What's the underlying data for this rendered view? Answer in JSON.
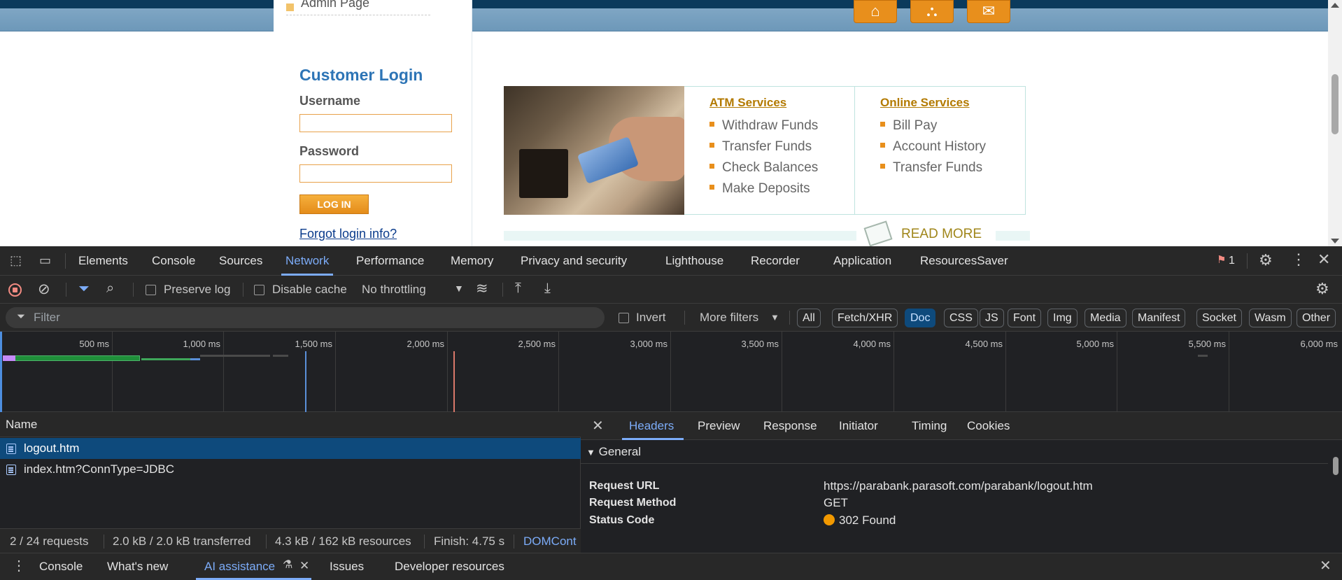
{
  "website": {
    "admin_link": "Admin Page",
    "login": {
      "title": "Customer Login",
      "username_label": "Username",
      "password_label": "Password",
      "login_button": "LOG IN",
      "forgot_link": "Forgot login info?"
    },
    "atm_services": {
      "heading": "ATM Services",
      "items": [
        "Withdraw Funds",
        "Transfer Funds",
        "Check Balances",
        "Make Deposits"
      ]
    },
    "online_services": {
      "heading": "Online Services",
      "items": [
        "Bill Pay",
        "Account History",
        "Transfer Funds"
      ]
    },
    "read_more": "READ MORE",
    "top_icons": [
      "home-icon",
      "about-icon",
      "contact-mail-icon"
    ]
  },
  "devtools": {
    "tabs": [
      "Elements",
      "Console",
      "Sources",
      "Network",
      "Performance",
      "Memory",
      "Privacy and security",
      "Lighthouse",
      "Recorder",
      "Application",
      "ResourcesSaver"
    ],
    "active_tab": "Network",
    "issues_count": "1",
    "toolbar": {
      "preserve_log": "Preserve log",
      "disable_cache": "Disable cache",
      "throttling": "No throttling"
    },
    "filter": {
      "placeholder": "Filter",
      "invert": "Invert",
      "more_filters": "More filters",
      "types": [
        "All",
        "Fetch/XHR",
        "Doc",
        "CSS",
        "JS",
        "Font",
        "Img",
        "Media",
        "Manifest",
        "Socket",
        "Wasm",
        "Other"
      ],
      "active_type": "Doc"
    },
    "timeline_ticks": [
      "500 ms",
      "1,000 ms",
      "1,500 ms",
      "2,000 ms",
      "2,500 ms",
      "3,000 ms",
      "3,500 ms",
      "4,000 ms",
      "4,500 ms",
      "5,000 ms",
      "5,500 ms",
      "6,000 ms"
    ],
    "request_list": {
      "column_name": "Name",
      "rows": [
        "logout.htm",
        "index.htm?ConnType=JDBC"
      ],
      "selected": "logout.htm"
    },
    "status": {
      "requests": "2 / 24 requests",
      "transferred": "2.0 kB / 2.0 kB transferred",
      "resources": "4.3 kB / 162 kB resources",
      "finish": "Finish: 4.75 s",
      "domcontent": "DOMCont"
    },
    "detail": {
      "tabs": [
        "Headers",
        "Preview",
        "Response",
        "Initiator",
        "Timing",
        "Cookies"
      ],
      "active_tab": "Headers",
      "section": "General",
      "fields": [
        {
          "key": "Request URL",
          "value": "https://parabank.parasoft.com/parabank/logout.htm"
        },
        {
          "key": "Request Method",
          "value": "GET"
        },
        {
          "key": "Status Code",
          "value": "302 Found"
        }
      ],
      "status_color": "#f29900"
    },
    "drawer_tabs": [
      "Console",
      "What's new",
      "AI assistance",
      "Issues",
      "Developer resources"
    ],
    "drawer_active": "AI assistance",
    "colors": {
      "accent": "#7cacf8",
      "selection": "#0e4a7c",
      "record": "#f28b82"
    }
  }
}
